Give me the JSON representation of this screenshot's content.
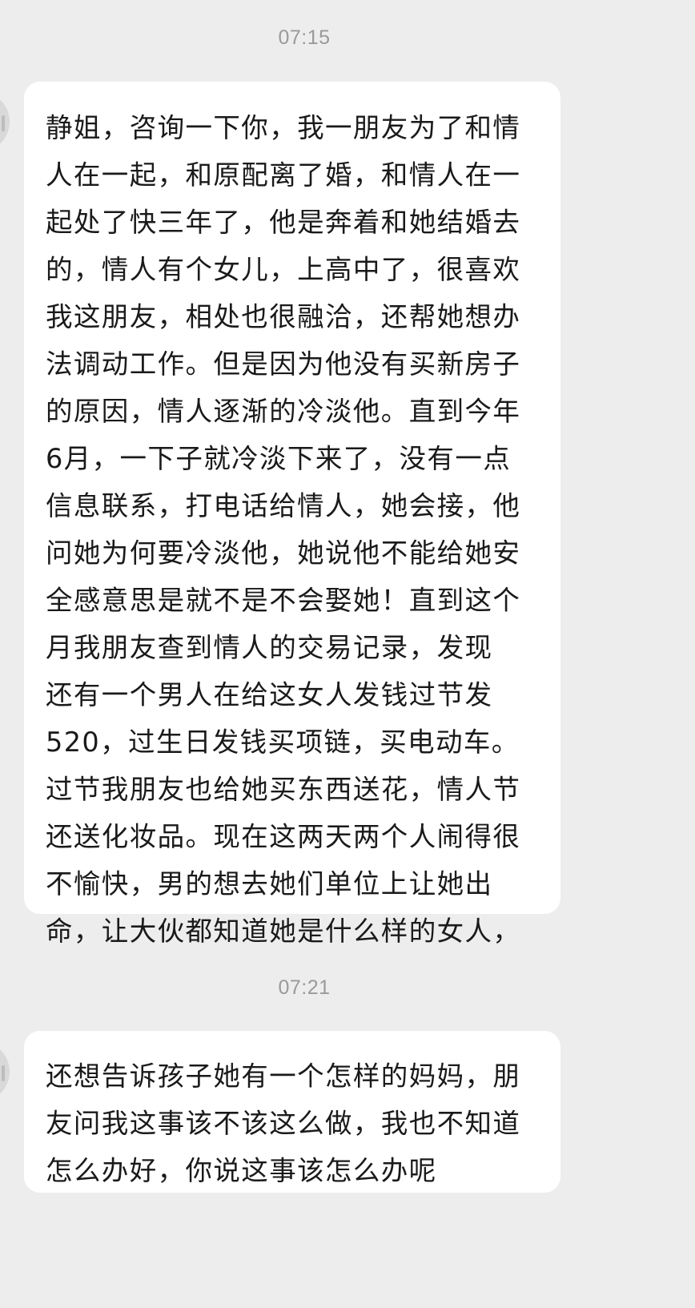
{
  "chat": {
    "messages": [
      {
        "time": "07:15",
        "text": "静姐，咨询一下你，我一朋友为了和情\n人在一起，和原配离了婚，和情人在一\n起处了快三年了，他是奔着和她结婚去\n的，情人有个女儿，上高中了，很喜欢\n我这朋友，相处也很融洽，还帮她想办\n法调动工作。但是因为他没有买新房子\n的原因，情人逐渐的冷淡他。直到今年\n6月，一下子就冷淡下来了，没有一点\n信息联系，打电话给情人，她会接，他\n问她为何要冷淡他，她说他不能给她安\n全感意思是就不是不会娶她！直到这个\n月我朋友查到情人的交易记录，发现\n还有一个男人在给这女人发钱过节发\n520，过生日发钱买项链，买电动车。\n过节我朋友也给她买东西送花，情人节\n还送化妆品。现在这两天两个人闹得很\n不愉快，男的想去她们单位上让她出\n命，让大伙都知道她是什么样的女人，"
      },
      {
        "time": "07:21",
        "text": "还想告诉孩子她有一个怎样的妈妈，朋\n友问我这事该不该这么做，我也不知道\n怎么办好，你说这事该怎么办呢"
      }
    ]
  }
}
